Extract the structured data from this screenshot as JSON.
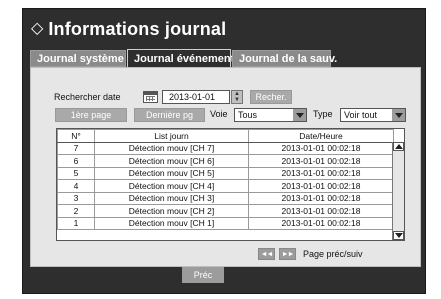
{
  "window": {
    "title": "Informations journal",
    "title_icon": "diamond-icon"
  },
  "tabs": [
    {
      "label": "Journal système",
      "active": false
    },
    {
      "label": "Journal événements",
      "active": true
    },
    {
      "label": "Journal de la sauv.",
      "active": false
    }
  ],
  "search": {
    "label": "Rechercher date",
    "date_value": "2013-01-01",
    "search_button": "Recher.",
    "calendar_icon": "calendar-icon"
  },
  "filters": {
    "first_page_button": "1ère page",
    "last_page_button": "Dernière pg",
    "voie_label": "Voie",
    "voie_value": "Tous",
    "type_label": "Type",
    "type_value": "Voir tout"
  },
  "table": {
    "columns": [
      "N°",
      "List journ",
      "Date/Heure"
    ],
    "rows": [
      {
        "n": "7",
        "event": "Détection mouv [CH 7]",
        "datetime": "2013-01-01 00:02:18"
      },
      {
        "n": "6",
        "event": "Détection mouv [CH 6]",
        "datetime": "2013-01-01 00:02:18"
      },
      {
        "n": "5",
        "event": "Détection mouv [CH 5]",
        "datetime": "2013-01-01 00:02:18"
      },
      {
        "n": "4",
        "event": "Détection mouv [CH 4]",
        "datetime": "2013-01-01 00:02:18"
      },
      {
        "n": "3",
        "event": "Détection mouv [CH 3]",
        "datetime": "2013-01-01 00:02:18"
      },
      {
        "n": "2",
        "event": "Détection mouv [CH 2]",
        "datetime": "2013-01-01 00:02:18"
      },
      {
        "n": "1",
        "event": "Détection mouv [CH 1]",
        "datetime": "2013-01-01 00:02:18"
      }
    ]
  },
  "pagination": {
    "prev_icon": "rewind-icon",
    "next_icon": "fast-forward-icon",
    "prev_glyph": "◄◄",
    "next_glyph": "►►",
    "label": "Page préc/suiv"
  },
  "footer": {
    "prev_button": "Préc"
  },
  "colors": {
    "window_bg": "#2e2e2e",
    "panel_bg": "#e6e6e6",
    "button_bg": "#a9a9a9"
  }
}
